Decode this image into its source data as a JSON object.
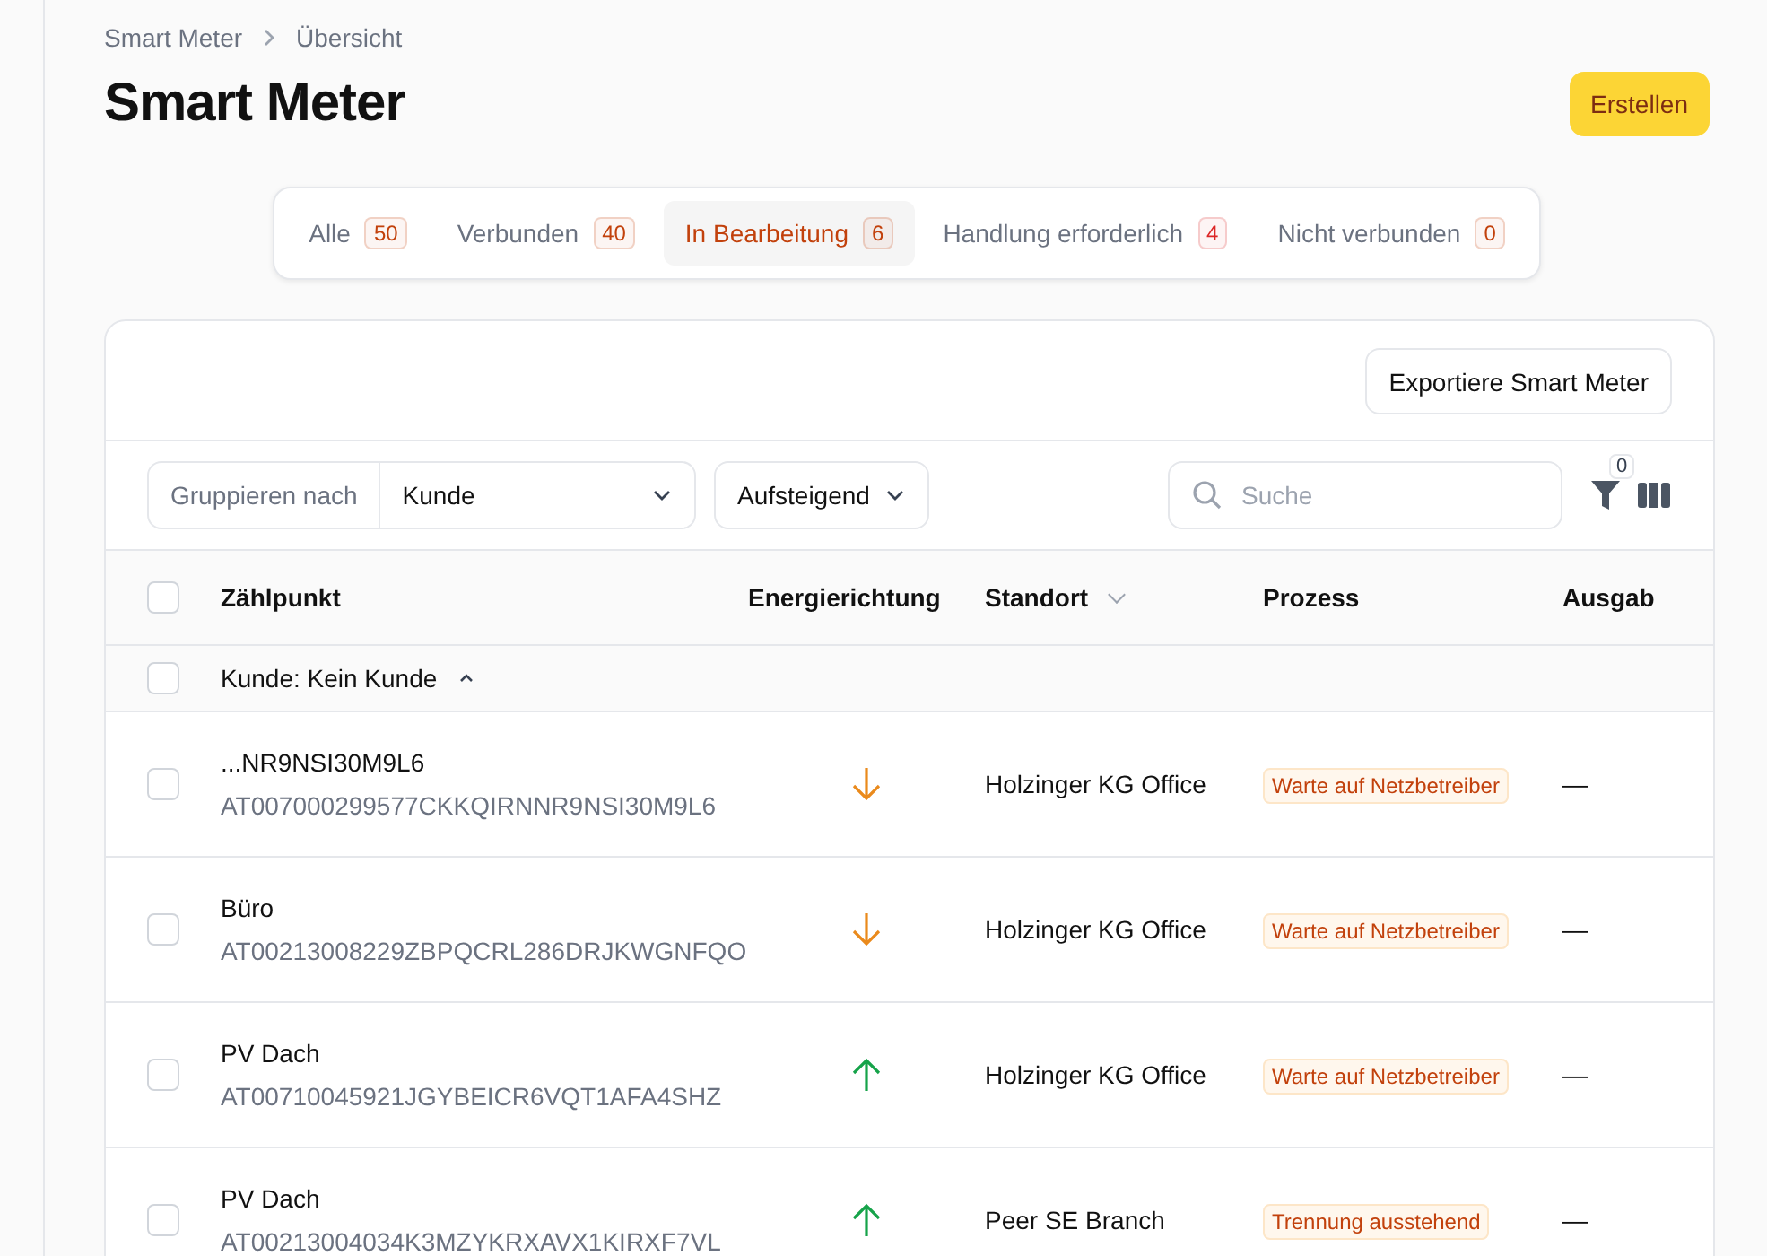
{
  "breadcrumb": [
    "Smart Meter",
    "Übersicht"
  ],
  "title": "Smart Meter",
  "create_button": "Erstellen",
  "tabs": [
    {
      "label": "Alle",
      "count": "50",
      "color": "#c2410c",
      "selected": false
    },
    {
      "label": "Verbunden",
      "count": "40",
      "color": "#c2410c",
      "selected": false
    },
    {
      "label": "In Bearbeitung",
      "count": "6",
      "color": "#c2410c",
      "selected": true
    },
    {
      "label": "Handlung erforderlich",
      "count": "4",
      "color": "#dc2626",
      "selected": false
    },
    {
      "label": "Nicht verbunden",
      "count": "0",
      "color": "#c2410c",
      "selected": false
    }
  ],
  "export_button": "Exportiere Smart Meter",
  "group_by": {
    "label": "Gruppieren nach",
    "value": "Kunde"
  },
  "sort": {
    "value": "Aufsteigend"
  },
  "search": {
    "placeholder": "Suche"
  },
  "filter_count": "0",
  "table": {
    "all_checked": false,
    "columns": [
      {
        "label": "Zählpunkt",
        "sortable": false
      },
      {
        "label": "Energierichtung",
        "sortable": false
      },
      {
        "label": "Standort",
        "sortable": true
      },
      {
        "label": "Prozess",
        "sortable": false
      },
      {
        "label": "Ausgab",
        "sortable": false
      }
    ],
    "group": {
      "label": "Kunde: Kein Kunde",
      "checked": false,
      "expanded": true
    },
    "rows": [
      {
        "name": "...NR9NSI30M9L6",
        "id": "AT007000299577CKKQIRNNR9NSI30M9L6",
        "kind": "down",
        "location": "Holzinger KG Office",
        "process": "Warte auf Netzbetreiber",
        "output": "—",
        "checked": false
      },
      {
        "name": "Büro",
        "id": "AT00213008229ZBPQCRL286DRJKWGNFQO",
        "kind": "down",
        "location": "Holzinger KG Office",
        "process": "Warte auf Netzbetreiber",
        "output": "—",
        "checked": false
      },
      {
        "name": "PV Dach",
        "id": "AT00710045921JGYBEICR6VQT1AFA4SHZ",
        "kind": "up",
        "location": "Holzinger KG Office",
        "process": "Warte auf Netzbetreiber",
        "output": "—",
        "checked": false
      },
      {
        "name": "PV Dach",
        "id": "AT00213004034K3MZYKRXAVX1KIRXF7VL",
        "kind": "up",
        "location": "Peer SE Branch",
        "process": "Trennung ausstehend",
        "output": "—",
        "checked": false
      }
    ]
  }
}
